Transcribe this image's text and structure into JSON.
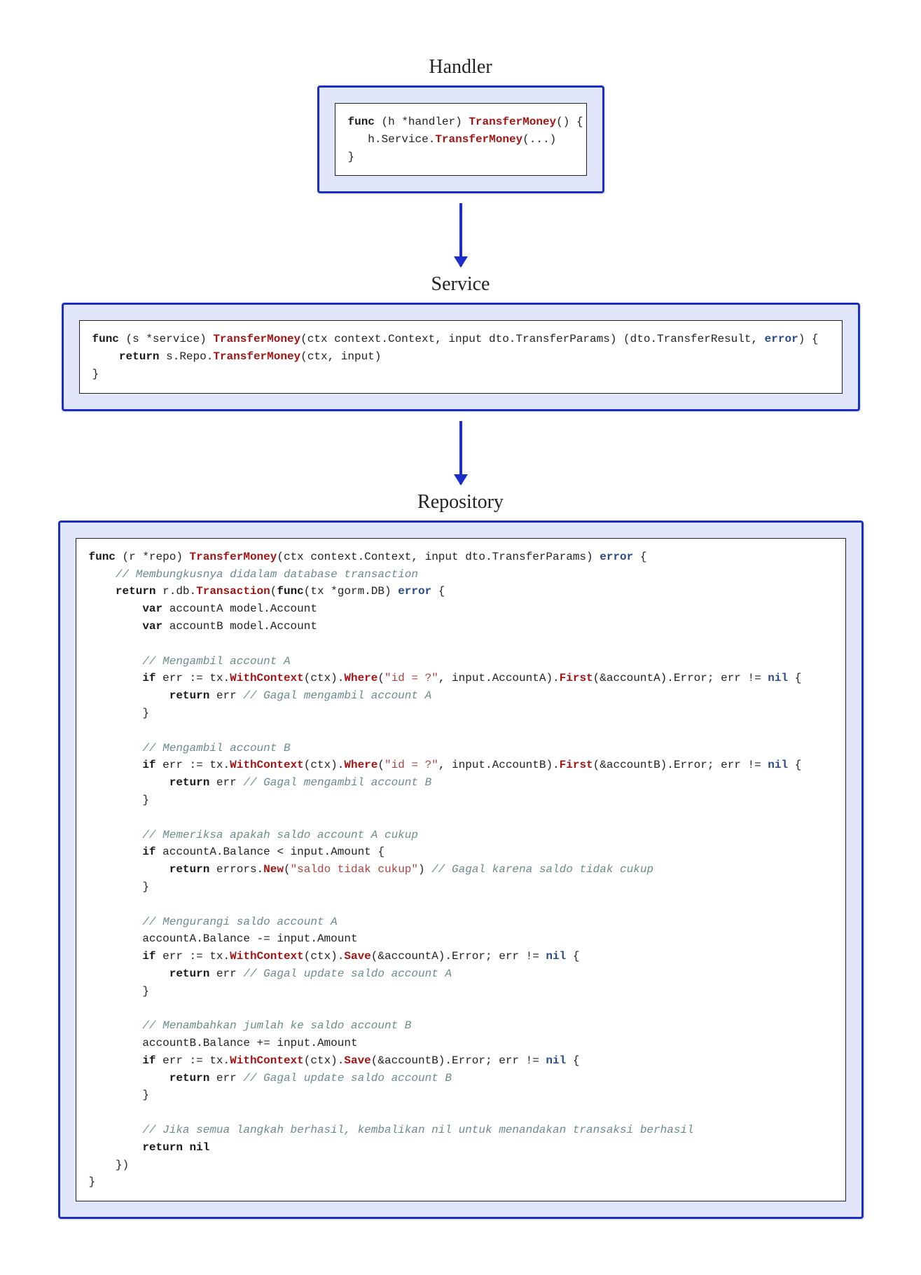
{
  "labels": {
    "handler": "Handler",
    "service": "Service",
    "repository": "Repository"
  },
  "handler": {
    "l1a": "func",
    "l1b": " (h *handler) ",
    "l1c": "TransferMoney",
    "l1d": "() {",
    "l2a": "   h.Service.",
    "l2b": "TransferMoney",
    "l2c": "(...)",
    "l3": "}"
  },
  "service": {
    "l1a": "func",
    "l1b": " (s *service) ",
    "l1c": "TransferMoney",
    "l1d": "(ctx context.Context, input dto.TransferParams) (dto.TransferResult, ",
    "l1e": "error",
    "l1f": ") {",
    "l2a": "    ",
    "l2b": "return",
    "l2c": " s.Repo.",
    "l2d": "TransferMoney",
    "l2e": "(ctx, input)",
    "l3": "}"
  },
  "repo": {
    "l01a": "func",
    "l01b": " (r *repo) ",
    "l01c": "TransferMoney",
    "l01d": "(ctx context.Context, input dto.TransferParams) ",
    "l01e": "error",
    "l01f": " {",
    "l02": "    // Membungkusnya didalam database transaction",
    "l03a": "    ",
    "l03b": "return",
    "l03c": " r.db.",
    "l03d": "Transaction",
    "l03e": "(",
    "l03f": "func",
    "l03g": "(tx *gorm.DB) ",
    "l03h": "error",
    "l03i": " {",
    "l04a": "        ",
    "l04b": "var",
    "l04c": " accountA model.Account",
    "l05a": "        ",
    "l05b": "var",
    "l05c": " accountB model.Account",
    "blank": "",
    "l07": "        // Mengambil account A",
    "l08a": "        ",
    "l08b": "if",
    "l08c": " err := tx.",
    "l08d": "WithContext",
    "l08e": "(ctx).",
    "l08f": "Where",
    "l08g": "(",
    "l08h": "\"id = ?\"",
    "l08i": ", input.AccountA).",
    "l08j": "First",
    "l08k": "(&accountA).Error; err != ",
    "l08l": "nil",
    "l08m": " {",
    "l09a": "            ",
    "l09b": "return",
    "l09c": " err ",
    "l09d": "// Gagal mengambil account A",
    "l10": "        }",
    "l12": "        // Mengambil account B",
    "l13a": "        ",
    "l13b": "if",
    "l13c": " err := tx.",
    "l13d": "WithContext",
    "l13e": "(ctx).",
    "l13f": "Where",
    "l13g": "(",
    "l13h": "\"id = ?\"",
    "l13i": ", input.AccountB).",
    "l13j": "First",
    "l13k": "(&accountB).Error; err != ",
    "l13l": "nil",
    "l13m": " {",
    "l14a": "            ",
    "l14b": "return",
    "l14c": " err ",
    "l14d": "// Gagal mengambil account B",
    "l15": "        }",
    "l17": "        // Memeriksa apakah saldo account A cukup",
    "l18a": "        ",
    "l18b": "if",
    "l18c": " accountA.Balance < input.Amount {",
    "l19a": "            ",
    "l19b": "return",
    "l19c": " errors.",
    "l19d": "New",
    "l19e": "(",
    "l19f": "\"saldo tidak cukup\"",
    "l19g": ") ",
    "l19h": "// Gagal karena saldo tidak cukup",
    "l20": "        }",
    "l22": "        // Mengurangi saldo account A",
    "l23": "        accountA.Balance -= input.Amount",
    "l24a": "        ",
    "l24b": "if",
    "l24c": " err := tx.",
    "l24d": "WithContext",
    "l24e": "(ctx).",
    "l24f": "Save",
    "l24g": "(&accountA).Error; err != ",
    "l24h": "nil",
    "l24i": " {",
    "l25a": "            ",
    "l25b": "return",
    "l25c": " err ",
    "l25d": "// Gagal update saldo account A",
    "l26": "        }",
    "l28": "        // Menambahkan jumlah ke saldo account B",
    "l29": "        accountB.Balance += input.Amount",
    "l30a": "        ",
    "l30b": "if",
    "l30c": " err := tx.",
    "l30d": "WithContext",
    "l30e": "(ctx).",
    "l30f": "Save",
    "l30g": "(&accountB).Error; err != ",
    "l30h": "nil",
    "l30i": " {",
    "l31a": "            ",
    "l31b": "return",
    "l31c": " err ",
    "l31d": "// Gagal update saldo account B",
    "l32": "        }",
    "l34": "        // Jika semua langkah berhasil, kembalikan nil untuk menandakan transaksi berhasil",
    "l35a": "        ",
    "l35b": "return nil",
    "l36": "    })",
    "l37": "}"
  }
}
